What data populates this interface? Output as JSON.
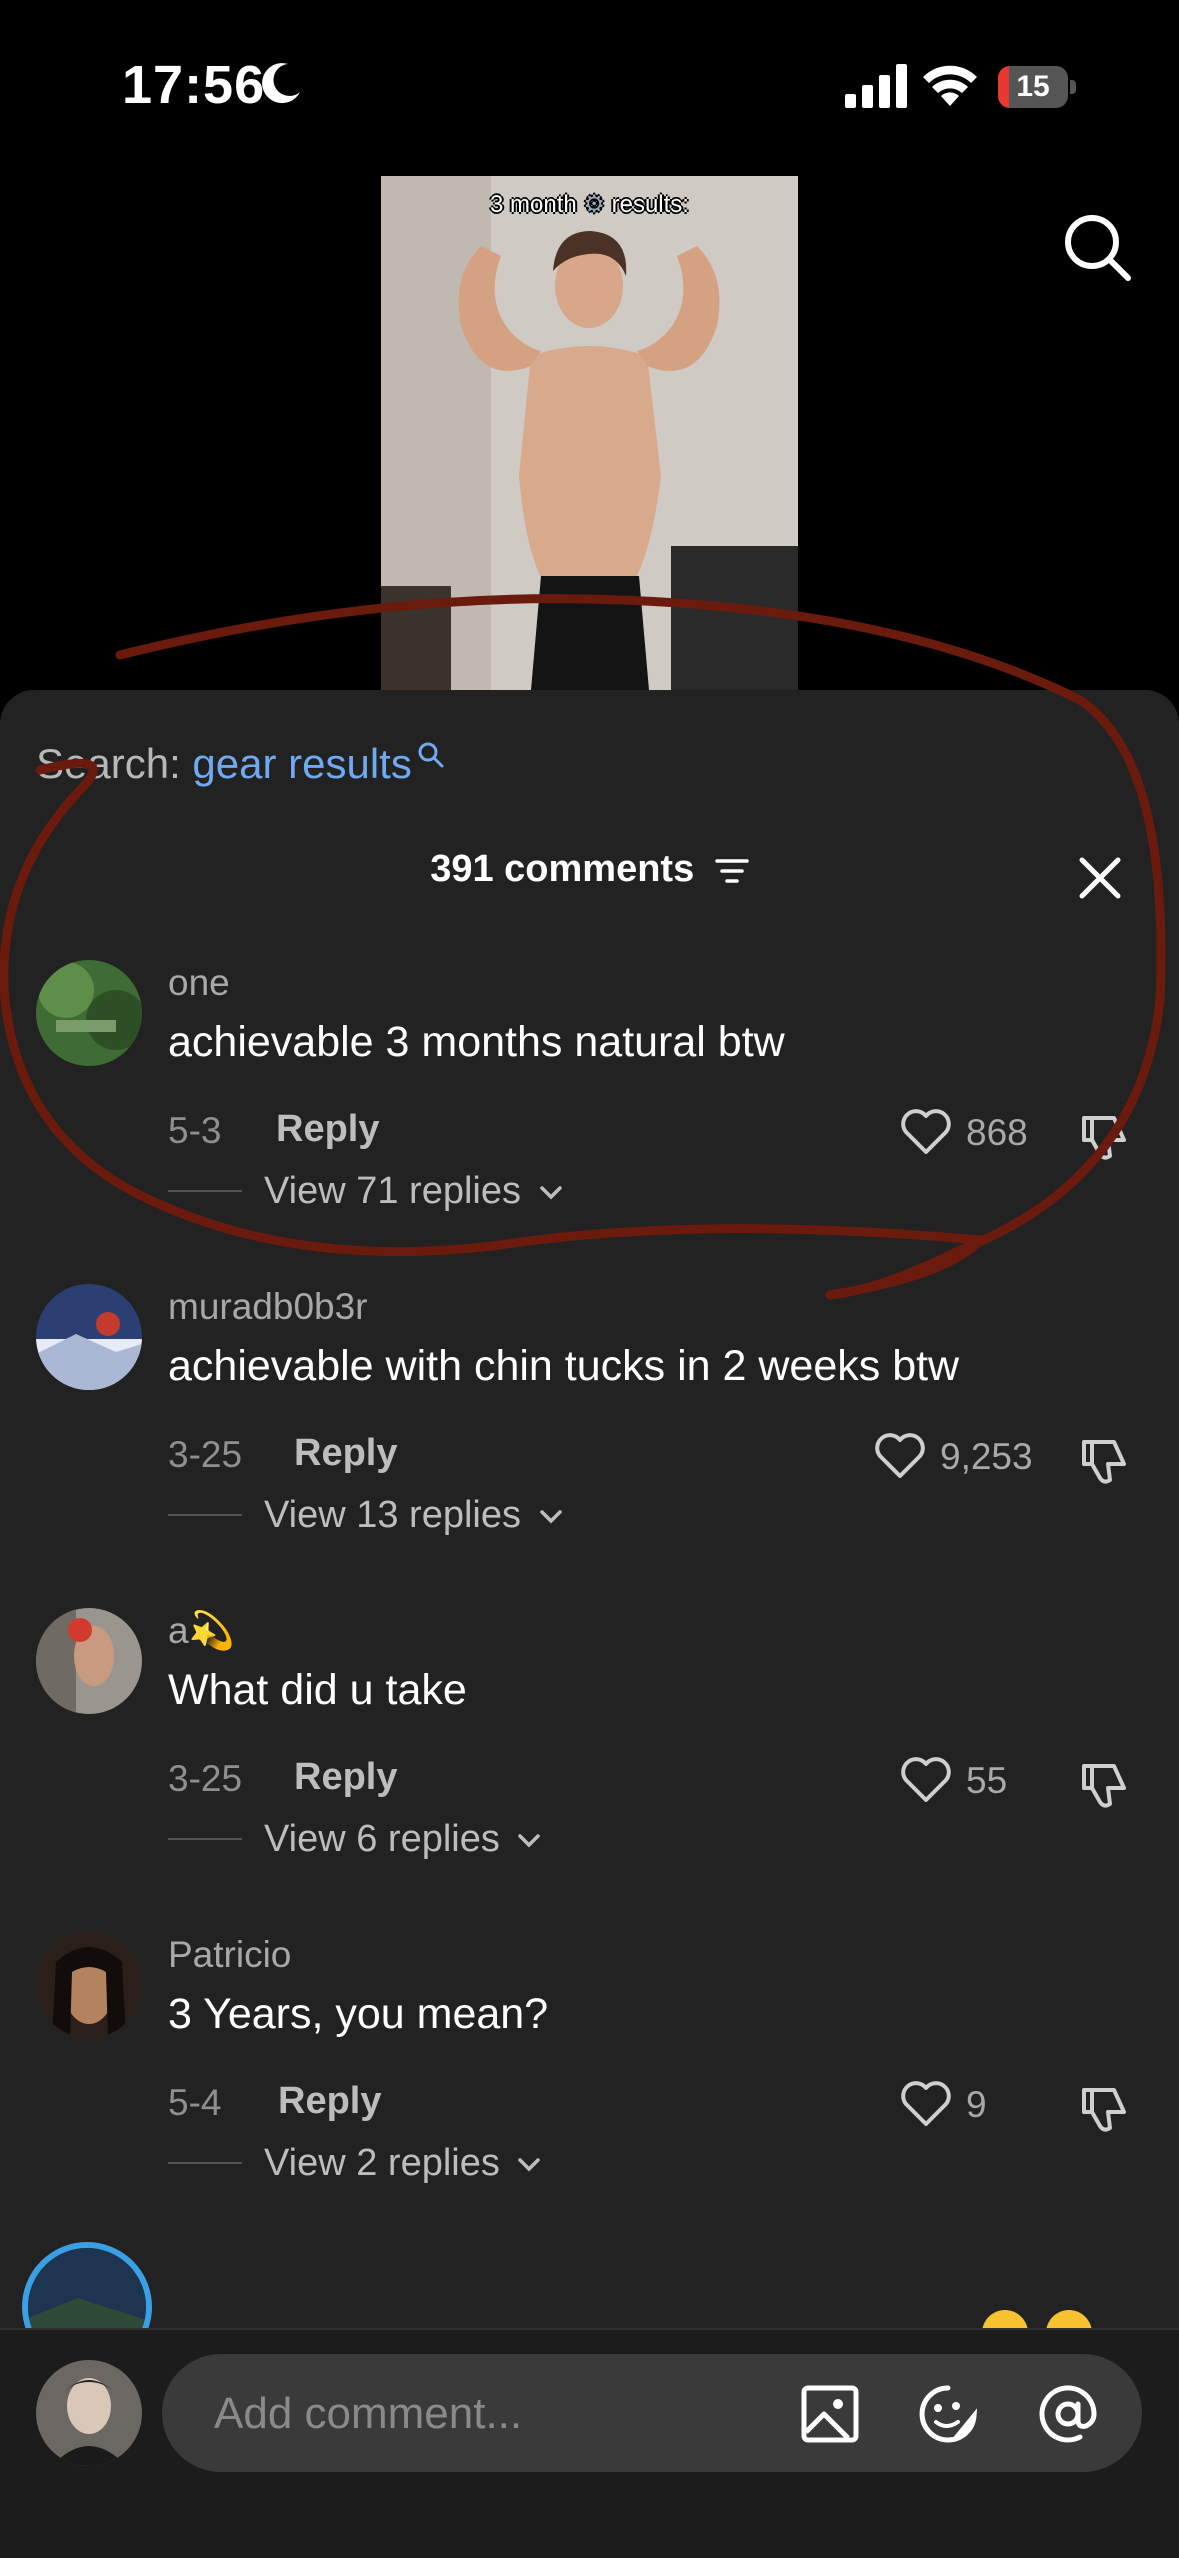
{
  "status_bar": {
    "time": "17:56",
    "focus_icon": "moon-icon",
    "battery_level": "15",
    "battery_fraction": 0.15
  },
  "video": {
    "caption_part1": "3 month",
    "caption_part2": "results:"
  },
  "sheet": {
    "search_label": "Search:",
    "search_term": "gear results",
    "comment_count": "391 comments"
  },
  "comments": [
    {
      "username": "one",
      "text": "achievable 3 months natural btw",
      "date": "5-3",
      "reply_label": "Reply",
      "likes": "868",
      "view_replies": "View 71 replies"
    },
    {
      "username": "muradb0b3r",
      "text": "achievable with chin tucks in 2 weeks btw",
      "date": "3-25",
      "reply_label": "Reply",
      "likes": "9,253",
      "view_replies": "View 13 replies"
    },
    {
      "username": "a💫",
      "text": "What did u take",
      "date": "3-25",
      "reply_label": "Reply",
      "likes": "55",
      "view_replies": "View 6 replies"
    },
    {
      "username": "Patricio",
      "text": "3 Years, you mean?",
      "date": "5-4",
      "reply_label": "Reply",
      "likes": "9",
      "view_replies": "View 2 replies"
    }
  ],
  "composer": {
    "placeholder": "Add comment..."
  },
  "colors": {
    "sheet_bg": "#222222",
    "accent_link": "#6fa9f0",
    "battery_low": "#e8382f",
    "annotation": "#6b1a0e"
  }
}
